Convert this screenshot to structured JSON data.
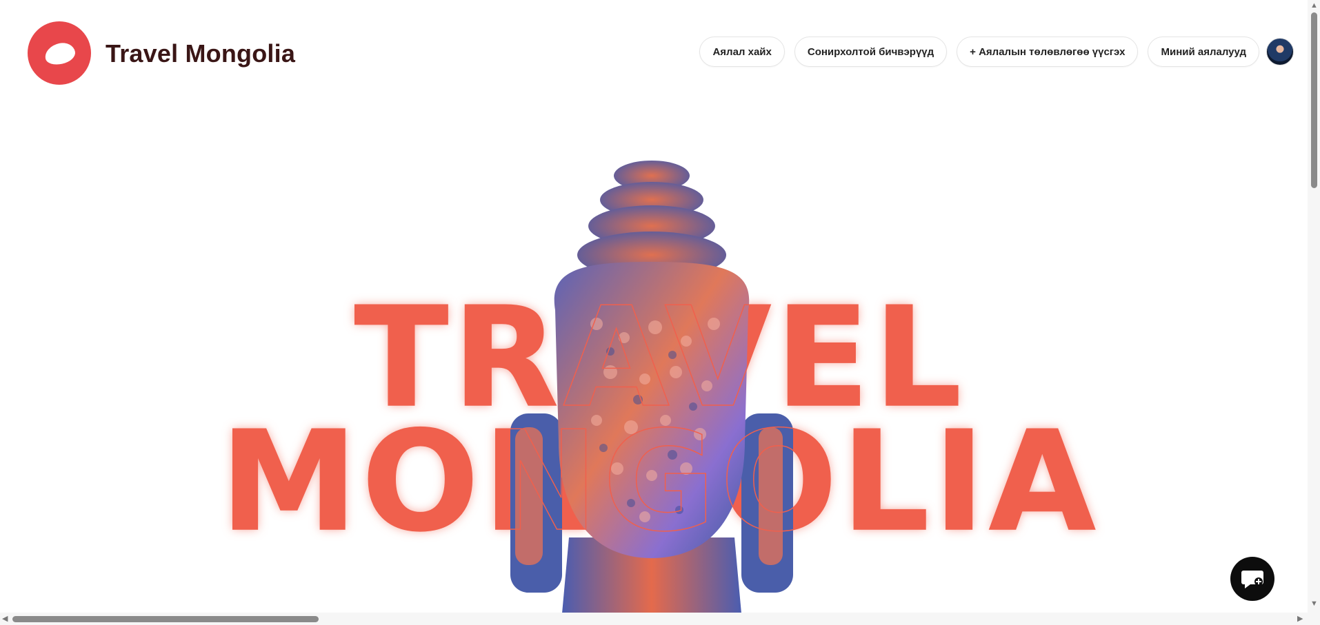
{
  "header": {
    "brand": "Travel Mongolia",
    "nav": [
      {
        "label": "Аялал хайх"
      },
      {
        "label": "Сонирхолтой бичвэрүүд"
      },
      {
        "label": "+ Аялалын төлөвлөгөө үүсгэх"
      },
      {
        "label": "Миний аялалууд"
      }
    ]
  },
  "hero": {
    "line1": "TRAVEL",
    "line2": "MONGOLIA"
  },
  "colors": {
    "accent": "#f0604d",
    "logo": "#e8474b",
    "brand_text": "#3a1616"
  },
  "icons": {
    "logo": "logo-icon",
    "chat": "chat-icon",
    "avatar": "user-avatar"
  }
}
